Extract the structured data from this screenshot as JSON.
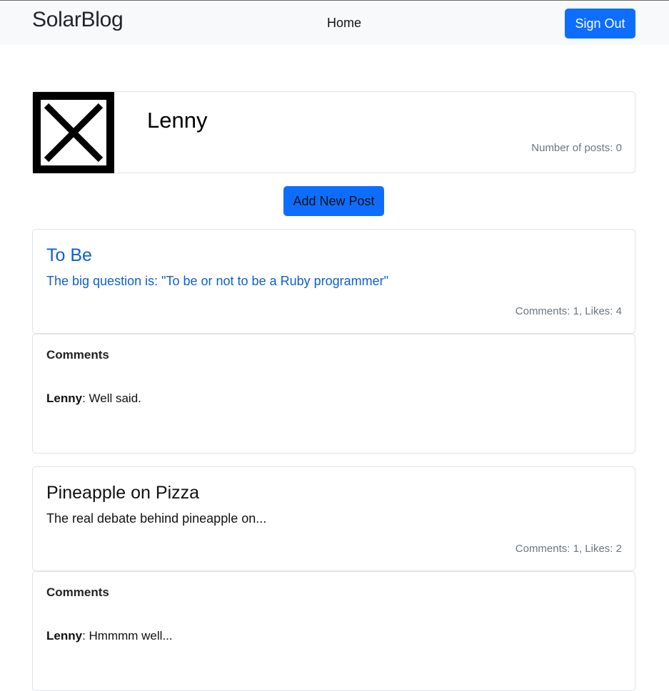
{
  "navbar": {
    "brand": "SolarBlog",
    "home_link": "Home",
    "sign_out": "Sign Out"
  },
  "user": {
    "name": "Lenny",
    "posts_label": "Number of posts: 0",
    "avatar_icon": "broken-image-icon"
  },
  "actions": {
    "add_post": "Add New Post"
  },
  "posts": [
    {
      "title": "To Be",
      "body": "The big question is: \"To be or not to be a Ruby programmer\"",
      "stats": "Comments: 1, Likes: 4",
      "comments_heading": "Comments",
      "comment_author": "Lenny",
      "comment_text": ": Well said."
    },
    {
      "title": "Pineapple on Pizza",
      "body": "The real debate behind pineapple on...",
      "stats": "Comments: 1, Likes: 2",
      "comments_heading": "Comments",
      "comment_author": "Lenny",
      "comment_text": ": Hmmmm well..."
    }
  ],
  "colors": {
    "primary": "#0d6efd",
    "link": "#0d5fd0",
    "muted": "#6c757d",
    "navbar_bg": "#f8f9fa"
  }
}
